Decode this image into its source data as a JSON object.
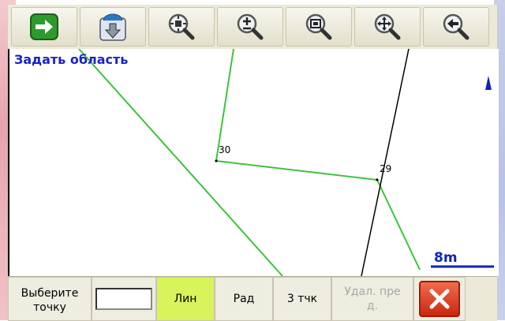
{
  "toolbar": {
    "buttons": [
      {
        "name": "next-arrow-icon"
      },
      {
        "name": "compass-download-icon"
      },
      {
        "name": "zoom-extent-icon"
      },
      {
        "name": "zoom-in-out-icon"
      },
      {
        "name": "zoom-window-icon"
      },
      {
        "name": "pan-icon"
      },
      {
        "name": "back-icon"
      }
    ]
  },
  "map": {
    "title": "Задать область",
    "points": [
      {
        "label": "30"
      },
      {
        "label": "29"
      }
    ],
    "scale_label": "8m",
    "colors": {
      "line": "#3cc33c",
      "axis": "#000000",
      "scale": "#1122bb"
    }
  },
  "bottom": {
    "choose_point": "Выберите\nточку",
    "input_value": "",
    "line_label": "Лин",
    "radius_label": "Рад",
    "three_points_label": "3 тчк",
    "delete_prev_label": "Удал. пре\nд.",
    "close_icon": "close-icon"
  }
}
